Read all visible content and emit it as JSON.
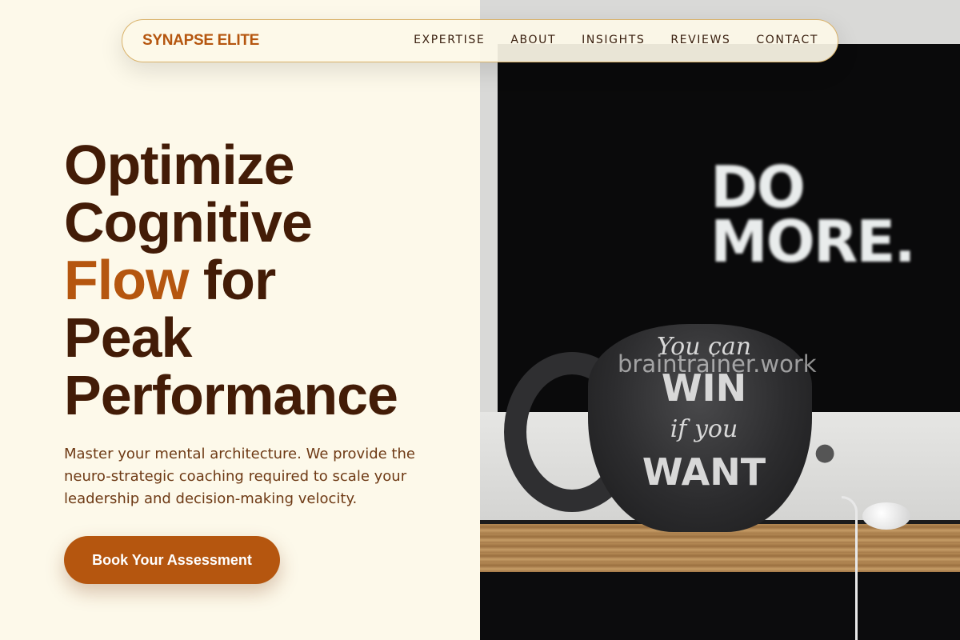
{
  "brand": "SYNAPSE ELITE",
  "nav": {
    "items": [
      {
        "label": "EXPERTISE"
      },
      {
        "label": "ABOUT"
      },
      {
        "label": "INSIGHTS"
      },
      {
        "label": "REVIEWS"
      },
      {
        "label": "CONTACT"
      }
    ]
  },
  "hero": {
    "title_line1": "Optimize",
    "title_line2": "Cognitive",
    "title_accent": "Flow",
    "title_line3_rest": " for",
    "title_line4": "Peak",
    "title_line5": "Performance",
    "subtitle": "Master your mental architecture. We provide the neuro-strategic coaching required to scale your leadership and decision-making velocity.",
    "cta_label": "Book Your Assessment"
  },
  "image": {
    "screen_text_line1": "DO",
    "screen_text_line2": "MORE.",
    "mug_line1": "You can",
    "mug_line2": "WIN",
    "mug_line3": "if you",
    "mug_line4": "WANT",
    "watermark": "braintrainer.work"
  },
  "colors": {
    "accent": "#b5560f",
    "heading": "#431c07",
    "background": "#fdf9ea"
  }
}
